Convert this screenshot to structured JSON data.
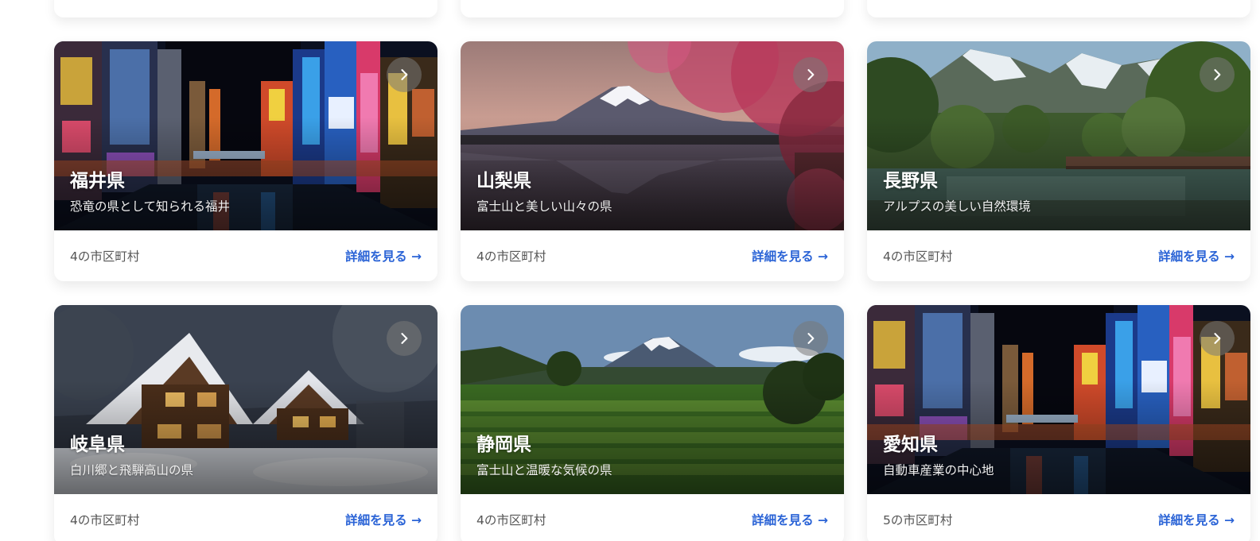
{
  "colors": {
    "accent": "#2a63d6",
    "count_text": "#555555"
  },
  "cards": [
    {
      "title": "福井県",
      "description": "恐竜の県として知られる福井",
      "count": "4の市区町村",
      "link": "詳細を見る →",
      "scene": "city-night"
    },
    {
      "title": "山梨県",
      "description": "富士山と美しい山々の県",
      "count": "4の市区町村",
      "link": "詳細を見る →",
      "scene": "fuji-sakura"
    },
    {
      "title": "長野県",
      "description": "アルプスの美しい自然環境",
      "count": "4の市区町村",
      "link": "詳細を見る →",
      "scene": "alps-river"
    },
    {
      "title": "岐阜県",
      "description": "白川郷と飛騨高山の県",
      "count": "4の市区町村",
      "link": "詳細を見る →",
      "scene": "snow-village"
    },
    {
      "title": "静岡県",
      "description": "富士山と温暖な気候の県",
      "count": "4の市区町村",
      "link": "詳細を見る →",
      "scene": "fuji-tea"
    },
    {
      "title": "愛知県",
      "description": "自動車産業の中心地",
      "count": "5の市区町村",
      "link": "詳細を見る →",
      "scene": "city-night"
    }
  ],
  "icons": {
    "card_arrow": "chevron-right-icon"
  }
}
